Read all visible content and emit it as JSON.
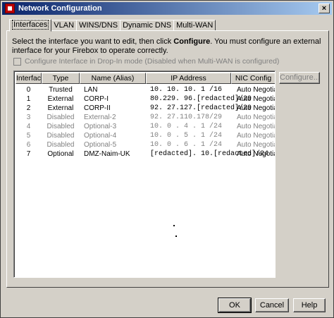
{
  "window": {
    "title": "Network Configuration",
    "close_glyph": "×"
  },
  "tabs": [
    {
      "label": "Interfaces",
      "active": true
    },
    {
      "label": "VLAN",
      "active": false
    },
    {
      "label": "WINS/DNS",
      "active": false
    },
    {
      "label": "Dynamic DNS",
      "active": false
    },
    {
      "label": "Multi-WAN",
      "active": false
    }
  ],
  "instructions": {
    "part1": "Select the interface you want to edit, then click ",
    "emphasis": "Configure",
    "part2": ". You must configure an external interface for your Firebox to operate correctly."
  },
  "dropin_checkbox": {
    "label": "Configure Interface in Drop-In mode (Disabled when Multi-WAN is configured)",
    "checked": false,
    "enabled": false
  },
  "table": {
    "columns": [
      "Interface",
      "Type",
      "Name (Alias)",
      "IP Address",
      "NIC Config"
    ],
    "rows": [
      {
        "iface": "0",
        "type": "Trusted",
        "name": "LAN",
        "ip": "10. 10. 10. 1 /16",
        "nic": "Auto Negotiate",
        "disabled": false
      },
      {
        "iface": "1",
        "type": "External",
        "name": "CORP-I",
        "ip": "80.229. 96.[redacted]/29",
        "nic": "Auto Negotiate",
        "disabled": false
      },
      {
        "iface": "2",
        "type": "External",
        "name": "CORP-II",
        "ip": "92. 27.127.[redacted]/29",
        "nic": "Auto Negotiate",
        "disabled": false
      },
      {
        "iface": "3",
        "type": "Disabled",
        "name": "External-2",
        "ip": "92. 27.110.178/29",
        "nic": "Auto Negotiate",
        "disabled": true
      },
      {
        "iface": "4",
        "type": "Disabled",
        "name": "Optional-3",
        "ip": "10. 0 . 4 . 1 /24",
        "nic": "Auto Negotiate",
        "disabled": true
      },
      {
        "iface": "5",
        "type": "Disabled",
        "name": "Optional-4",
        "ip": "10. 0 . 5 . 1 /24",
        "nic": "Auto Negotiate",
        "disabled": true
      },
      {
        "iface": "6",
        "type": "Disabled",
        "name": "Optional-5",
        "ip": "10. 0 . 6 . 1 /24",
        "nic": "Auto Negotiate",
        "disabled": true
      },
      {
        "iface": "7",
        "type": "Optional",
        "name": "DMZ-Naim-UK",
        "ip": "[redacted]. 10.[redacted]/24",
        "nic": "Auto Negotiate",
        "disabled": false
      }
    ]
  },
  "buttons": {
    "configure": "Configure...",
    "ok": "OK",
    "cancel": "Cancel",
    "help": "Help"
  },
  "colors": {
    "titlebar_start": "#0a246a",
    "titlebar_end": "#a6caf0",
    "face": "#d4d0c8",
    "disabled_text": "#808080"
  }
}
